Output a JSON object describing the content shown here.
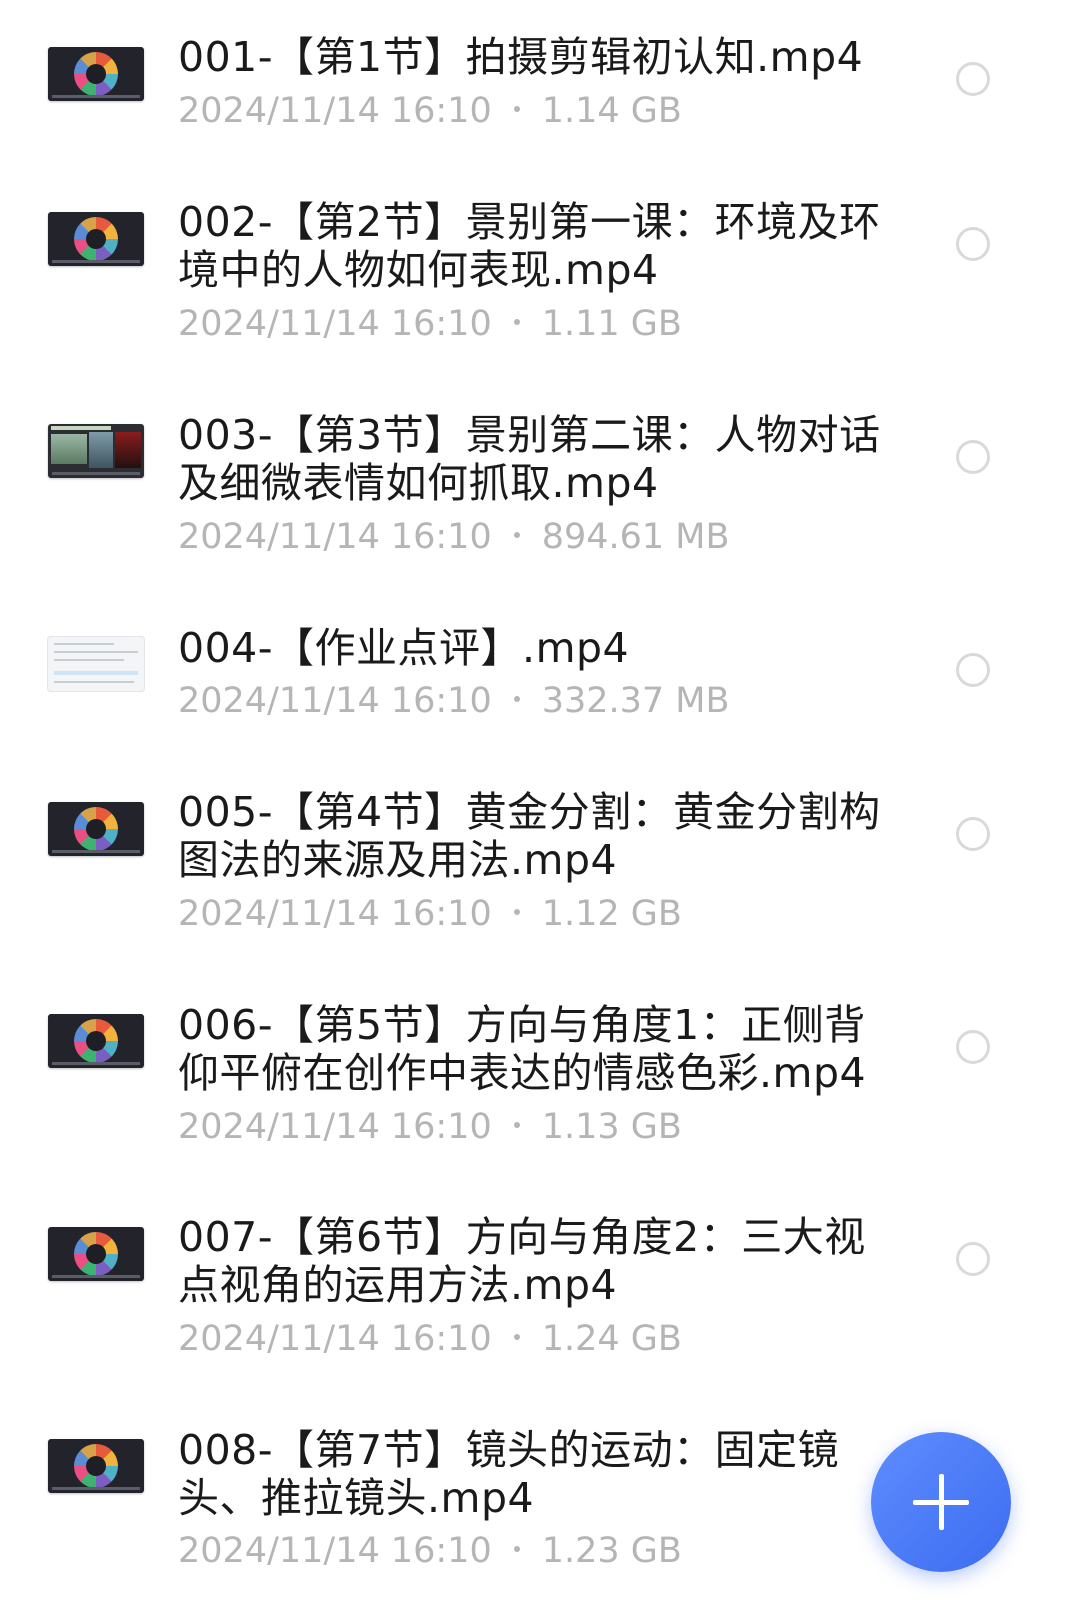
{
  "files": [
    {
      "title": "001-【第1节】拍摄剪辑初认知.mp4",
      "date": "2024/11/14 16:10",
      "size": "1.14 GB",
      "thumb": "course-cover-icon"
    },
    {
      "title": "002-【第2节】景别第一课：环境及环境中的人物如何表现.mp4",
      "date": "2024/11/14 16:10",
      "size": "1.11 GB",
      "thumb": "course-cover-icon"
    },
    {
      "title": "003-【第3节】景别第二课：人物对话及细微表情如何抓取.mp4",
      "date": "2024/11/14 16:10",
      "size": "894.61 MB",
      "thumb": "photo-collage-icon"
    },
    {
      "title": "004-【作业点评】.mp4",
      "date": "2024/11/14 16:10",
      "size": "332.37 MB",
      "thumb": "document-screen-icon"
    },
    {
      "title": "005-【第4节】黄金分割：黄金分割构图法的来源及用法.mp4",
      "date": "2024/11/14 16:10",
      "size": "1.12 GB",
      "thumb": "course-cover-icon"
    },
    {
      "title": "006-【第5节】方向与角度1：正侧背仰平俯在创作中表达的情感色彩.mp4",
      "date": "2024/11/14 16:10",
      "size": "1.13 GB",
      "thumb": "course-cover-icon"
    },
    {
      "title": "007-【第6节】方向与角度2：三大视点视角的运用方法.mp4",
      "date": "2024/11/14 16:10",
      "size": "1.24 GB",
      "thumb": "course-cover-icon"
    },
    {
      "title": "008-【第7节】镜头的运动：固定镜头、推拉镜头.mp4",
      "date": "2024/11/14 16:10",
      "size": "1.23 GB",
      "thumb": "course-cover-icon"
    }
  ],
  "fab": {
    "icon": "plus-icon",
    "color": "#4a7bf7"
  },
  "colors": {
    "title": "#1a1a1a",
    "meta": "#b5b5b5",
    "radio_border": "#d9d9d9"
  }
}
